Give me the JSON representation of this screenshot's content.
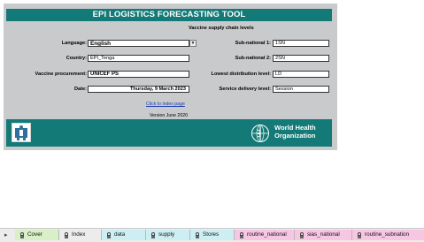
{
  "header": {
    "title": "EPI LOGISTICS FORECASTING TOOL"
  },
  "form": {
    "language_label": "Language:",
    "language_value": "English",
    "country_label": "Country:",
    "country_value": "EPI_Tenga",
    "procurement_label": "Vaccine procurement:",
    "procurement_value": "UNICEF PS",
    "date_label": "Date:",
    "date_value": "Thursday, 9 March 2023",
    "supply_chain_heading": "Vaccine supply chain levels",
    "subnat1_label": "Sub-national 1:",
    "subnat1_value": "1SN",
    "subnat2_label": "Sub-national 2:",
    "subnat2_value": "2SN",
    "lowest_label": "Lowest distribution level:",
    "lowest_value": "LD",
    "delivery_label": "Service delivery level:",
    "delivery_value": "Session",
    "index_link": "Click to index page",
    "version": "Version June 2020"
  },
  "footer": {
    "who_line1": "World Health",
    "who_line2": "Organization"
  },
  "tabs": [
    {
      "label": "Cover",
      "color": "#d8efc8"
    },
    {
      "label": "Index",
      "color": "#ececec"
    },
    {
      "label": "data",
      "color": "#cdeff3"
    },
    {
      "label": "supply",
      "color": "#cdeff3"
    },
    {
      "label": "Stores",
      "color": "#cdeff3"
    },
    {
      "label": "routine_national",
      "color": "#f7c6e3"
    },
    {
      "label": "sias_national",
      "color": "#f7c6e3"
    },
    {
      "label": "routine_subnation",
      "color": "#f7c6e3"
    }
  ]
}
